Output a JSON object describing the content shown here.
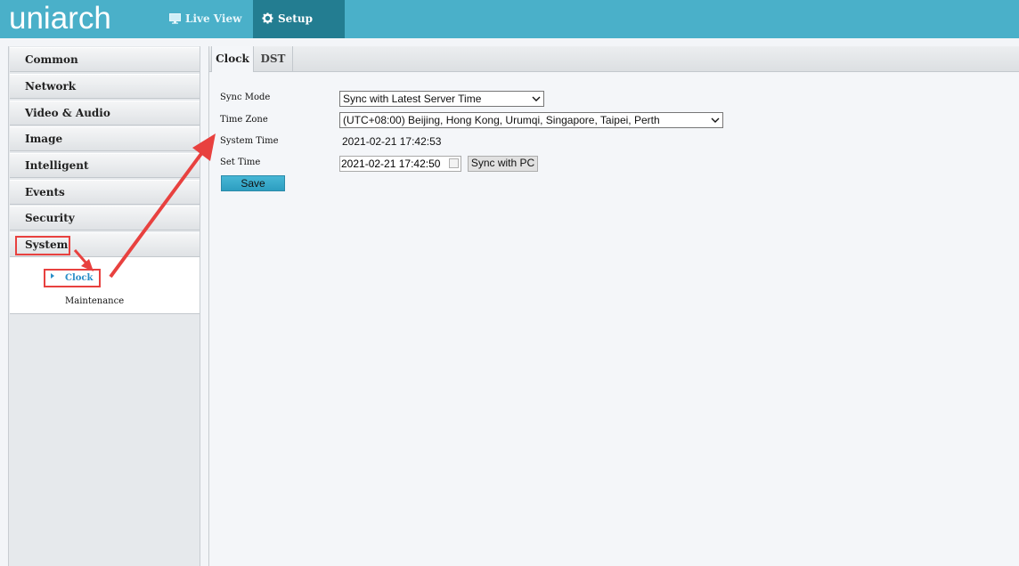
{
  "brand": {
    "logo": "uniarch"
  },
  "nav": {
    "live_view": "Live View",
    "setup": "Setup"
  },
  "sidebar": {
    "items": [
      {
        "label": "Common"
      },
      {
        "label": "Network"
      },
      {
        "label": "Video & Audio"
      },
      {
        "label": "Image"
      },
      {
        "label": "Intelligent"
      },
      {
        "label": "Events"
      },
      {
        "label": "Security"
      },
      {
        "label": "System"
      }
    ],
    "system_sub": {
      "clock": "Clock",
      "maintenance": "Maintenance"
    }
  },
  "tabs": {
    "clock": "Clock",
    "dst": "DST"
  },
  "form": {
    "sync_mode_label": "Sync Mode",
    "sync_mode_value": "Sync with Latest Server Time",
    "time_zone_label": "Time Zone",
    "time_zone_value": "(UTC+08:00) Beijing, Hong Kong, Urumqi, Singapore, Taipei, Perth",
    "system_time_label": "System Time",
    "system_time_value": "2021-02-21 17:42:53",
    "set_time_label": "Set Time",
    "set_time_value": "2021-02-21 17:42:50",
    "sync_pc_label": "Sync with PC",
    "save_label": "Save"
  },
  "colors": {
    "topbar": "#4ab0c9",
    "setup_active": "#237d91",
    "annotation_red": "#e8413f",
    "active_link": "#2a8ec8"
  }
}
